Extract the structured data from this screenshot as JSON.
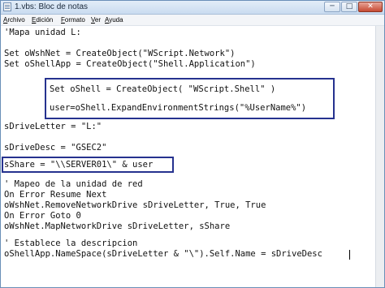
{
  "window": {
    "title": "1.vbs: Bloc de notas",
    "minimize_glyph": "─",
    "maximize_glyph": "□",
    "close_glyph": "✕"
  },
  "menu": {
    "items": [
      {
        "first": "A",
        "rest": "rchivo"
      },
      {
        "first": "E",
        "rest": "dición"
      },
      {
        "first": "F",
        "rest": "ormato"
      },
      {
        "first": "V",
        "rest": "er"
      },
      {
        "first": "A",
        "rest": "yuda"
      }
    ]
  },
  "code": {
    "lines": [
      "'Mapa unidad L:",
      "Set oWshNet = CreateObject(\"WScript.Network\")",
      "Set oShellApp = CreateObject(\"Shell.Application\")",
      "Set oShell = CreateObject( \"WScript.Shell\" )",
      "user=oShell.ExpandEnvironmentStrings(\"%UserName%\")",
      "sDriveLetter = \"L:\"",
      "sDriveDesc = \"GSEC2\"",
      "sShare = \"\\\\SERVER01\\\" & user",
      "' Mapeo de la unidad de red",
      "On Error Resume Next",
      "oWshNet.RemoveNetworkDrive sDriveLetter, True, True",
      "On Error Goto 0",
      "oWshNet.MapNetworkDrive sDriveLetter, sShare",
      "' Establece la descripcion",
      "oShellApp.NameSpace(sDriveLetter & \"\\\").Self.Name = sDriveDesc"
    ]
  },
  "colors": {
    "highlight_box": "#26328f",
    "titlebar": "#c9dbf0"
  }
}
